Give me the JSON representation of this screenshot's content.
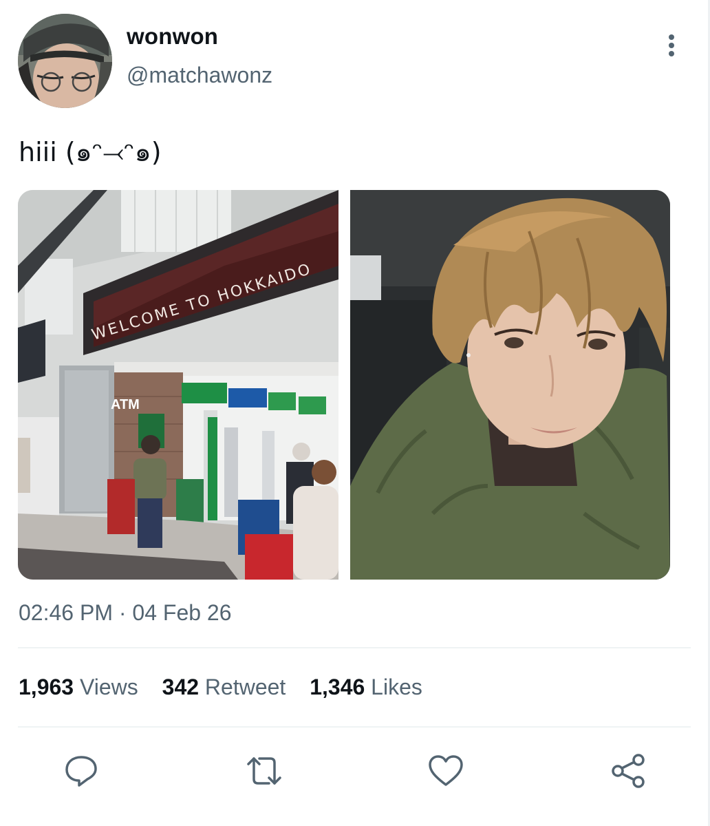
{
  "tweet": {
    "author": {
      "display_name": "wonwon",
      "handle": "@matchawonz"
    },
    "text": "hiii (๑ᵔ⤙ᵔ๑)",
    "media": [
      {
        "sign_text": "WELCOME TO HOKKAIDO",
        "atm_text": "ATM"
      },
      {}
    ],
    "timestamp": "02:46 PM · 04 Feb 26",
    "stats": {
      "views": {
        "count": "1,963",
        "label": "Views"
      },
      "retweets": {
        "count": "342",
        "label": "Retweet"
      },
      "likes": {
        "count": "1,346",
        "label": "Likes"
      }
    }
  },
  "icons": {
    "more": "more-vertical-icon",
    "reply": "reply-icon",
    "retweet": "retweet-icon",
    "like": "heart-icon",
    "share": "share-icon"
  },
  "colors": {
    "text_primary": "#0f1419",
    "text_secondary": "#536471",
    "icon": "#536471",
    "divider": "#eff3f4"
  }
}
